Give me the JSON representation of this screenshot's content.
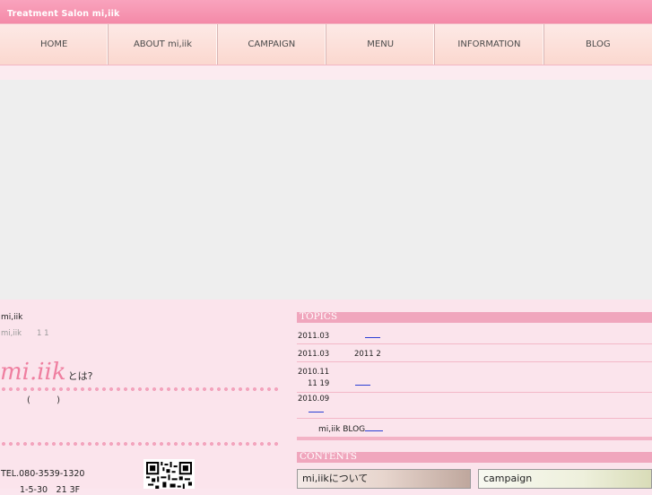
{
  "header": {
    "site_title": "Treatment Salon mi,iik"
  },
  "nav": {
    "items": [
      "HOME",
      "ABOUT mi,iik",
      "CAMPAIGN",
      "MENU",
      "INFORMATION",
      "BLOG"
    ]
  },
  "left": {
    "name": "mi,iik",
    "intro": "mi,iik　　1 1",
    "about_script": "mi.iik",
    "about_suffix": "とは?",
    "paren": "( )",
    "tel": "TEL.080-3539-1320",
    "address": "1-5-30　21 3F"
  },
  "topics": {
    "title": "TOPICS",
    "rows": [
      {
        "date": "2011.03",
        "text": ""
      },
      {
        "date": "2011.03",
        "text": "2011 2"
      },
      {
        "date": "2010.11",
        "text": "11 19"
      },
      {
        "date": "2010.09",
        "text": ""
      }
    ],
    "blog_label": "mi,iik BLOG"
  },
  "contents": {
    "title": "CONTENTS",
    "cards": [
      "mi,iikについて",
      "campaign"
    ]
  },
  "colors": {
    "accent_pink": "#f48aa8",
    "section_pink": "#f0a6bd",
    "link_blue": "#2b3fd4"
  }
}
